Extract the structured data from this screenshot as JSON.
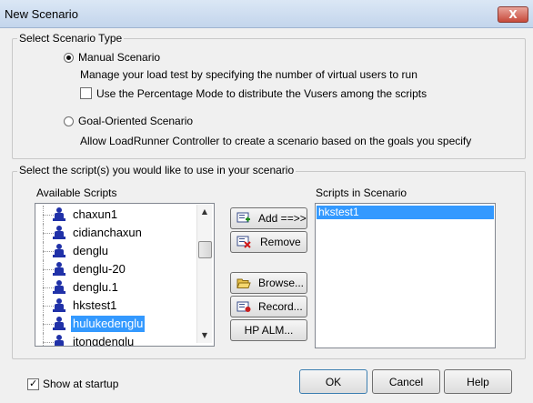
{
  "window": {
    "title": "New Scenario",
    "close_glyph": "X"
  },
  "scenario_type": {
    "legend": "Select Scenario Type",
    "manual": {
      "label": "Manual Scenario",
      "selected": true,
      "description": "Manage your load test by specifying the number of virtual users to run"
    },
    "percentage_mode": {
      "label": "Use the Percentage Mode to distribute the Vusers among the scripts",
      "checked": false
    },
    "goal": {
      "label": "Goal-Oriented Scenario",
      "selected": false,
      "description": "Allow LoadRunner Controller to create a scenario based on the goals you specify"
    }
  },
  "scripts": {
    "legend": "Select the script(s) you would like to use in your scenario",
    "available_label": "Available Scripts",
    "available": [
      {
        "name": "chaxun1",
        "selected": false
      },
      {
        "name": "cidianchaxun",
        "selected": false
      },
      {
        "name": "denglu",
        "selected": false
      },
      {
        "name": "denglu-20",
        "selected": false
      },
      {
        "name": "denglu.1",
        "selected": false
      },
      {
        "name": "hkstest1",
        "selected": false
      },
      {
        "name": "hulukedenglu",
        "selected": true
      },
      {
        "name": "itongdenglu",
        "selected": false
      }
    ],
    "scenario_label": "Scripts in Scenario",
    "in_scenario": [
      {
        "name": "hkstest1",
        "selected": true
      }
    ]
  },
  "buttons": {
    "add": "Add ==>>",
    "remove": "Remove",
    "browse": "Browse...",
    "record": "Record...",
    "hp_alm": "HP ALM...",
    "ok": "OK",
    "cancel": "Cancel",
    "help": "Help"
  },
  "show_at_startup": {
    "label": "Show at startup",
    "checked": true
  },
  "colors": {
    "selection": "#3399ff",
    "user_icon": "#2031a8"
  },
  "icons": {
    "script_item": "virtual-user-icon",
    "add": "add-script-icon",
    "remove": "remove-script-icon",
    "browse": "folder-open-icon",
    "record": "record-script-icon"
  }
}
